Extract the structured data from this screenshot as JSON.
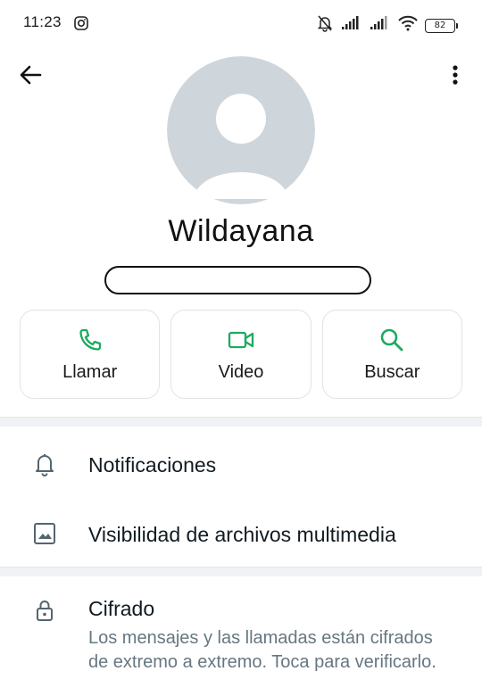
{
  "status_bar": {
    "time": "11:23",
    "battery": "82",
    "icons": [
      "instagram-icon",
      "bell-off-icon",
      "signal-icon",
      "signal-icon",
      "wifi-icon",
      "battery-icon"
    ]
  },
  "header": {
    "back_icon": "arrow-left-icon",
    "menu_icon": "more-vert-icon"
  },
  "profile": {
    "name": "Wildayana"
  },
  "actions": [
    {
      "label": "Llamar",
      "icon": "phone-icon"
    },
    {
      "label": "Video",
      "icon": "video-icon"
    },
    {
      "label": "Buscar",
      "icon": "search-icon"
    }
  ],
  "settings": {
    "notifications": "Notificaciones",
    "media_visibility": "Visibilidad de archivos multimedia"
  },
  "encryption": {
    "title": "Cifrado",
    "description": "Los mensajes y las llamadas están cifrados de extremo a extremo. Toca para verificarlo."
  },
  "colors": {
    "accent": "#1daa61",
    "avatar_bg": "#dfe5e7",
    "avatar_fg": "#ffffff",
    "secondary_text": "#667781"
  }
}
